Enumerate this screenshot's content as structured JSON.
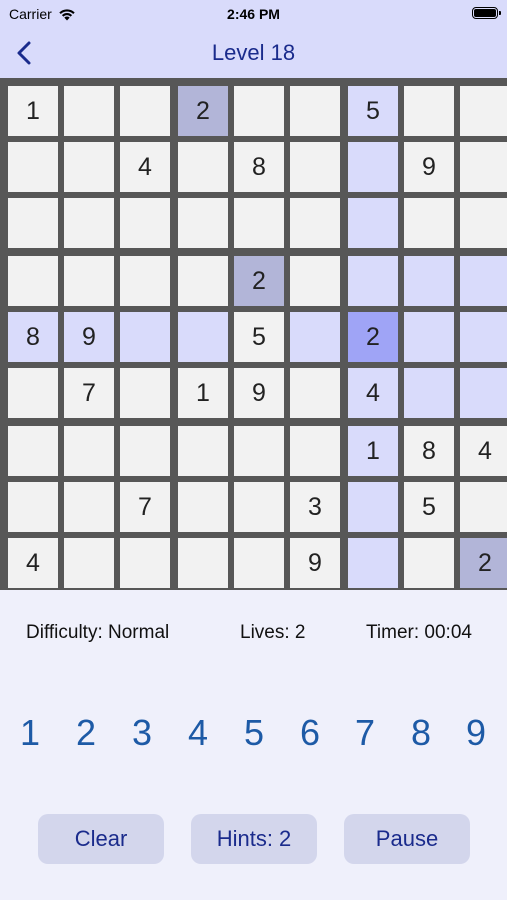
{
  "status_bar": {
    "carrier": "Carrier",
    "time": "2:46 PM"
  },
  "nav": {
    "title": "Level 18"
  },
  "board": {
    "rows": [
      [
        "1",
        "",
        "",
        "2",
        "",
        "",
        "5",
        "",
        ""
      ],
      [
        "",
        "",
        "4",
        "",
        "8",
        "",
        "",
        "9",
        ""
      ],
      [
        "",
        "",
        "",
        "",
        "",
        "",
        "",
        "",
        ""
      ],
      [
        "",
        "",
        "",
        "",
        "2",
        "",
        "",
        "",
        ""
      ],
      [
        "8",
        "9",
        "",
        "",
        "5",
        "",
        "2",
        "",
        ""
      ],
      [
        "",
        "7",
        "",
        "1",
        "9",
        "",
        "4",
        "",
        ""
      ],
      [
        "",
        "",
        "",
        "",
        "",
        "",
        "1",
        "8",
        "4"
      ],
      [
        "",
        "",
        "7",
        "",
        "",
        "3",
        "",
        "5",
        ""
      ],
      [
        "4",
        "",
        "",
        "",
        "",
        "9",
        "",
        "",
        "2"
      ]
    ],
    "highlights": [
      [
        "w",
        "w",
        "w",
        "g",
        "w",
        "w",
        "l",
        "w",
        "w"
      ],
      [
        "w",
        "w",
        "w",
        "w",
        "w",
        "w",
        "l",
        "w",
        "w"
      ],
      [
        "w",
        "w",
        "w",
        "w",
        "w",
        "w",
        "l",
        "w",
        "w"
      ],
      [
        "w",
        "w",
        "w",
        "w",
        "g",
        "w",
        "l",
        "l",
        "l"
      ],
      [
        "l",
        "l",
        "l",
        "l",
        "w",
        "l",
        "s",
        "l",
        "l"
      ],
      [
        "w",
        "w",
        "w",
        "w",
        "w",
        "w",
        "l",
        "l",
        "l"
      ],
      [
        "w",
        "w",
        "w",
        "w",
        "w",
        "w",
        "l",
        "w",
        "w"
      ],
      [
        "w",
        "w",
        "w",
        "w",
        "w",
        "w",
        "l",
        "w",
        "w"
      ],
      [
        "w",
        "w",
        "w",
        "w",
        "w",
        "w",
        "l",
        "w",
        "g"
      ]
    ],
    "colors": {
      "w": "#f2f2f2",
      "l": "#d9dbfb",
      "g": "#b2b5d8",
      "s": "#9fa4f6"
    }
  },
  "info": {
    "difficulty": "Difficulty: Normal",
    "lives": "Lives: 2",
    "timer": "Timer: 00:04"
  },
  "numpad": [
    "1",
    "2",
    "3",
    "4",
    "5",
    "6",
    "7",
    "8",
    "9"
  ],
  "buttons": {
    "clear": "Clear",
    "hints": "Hints: 2",
    "pause": "Pause"
  }
}
